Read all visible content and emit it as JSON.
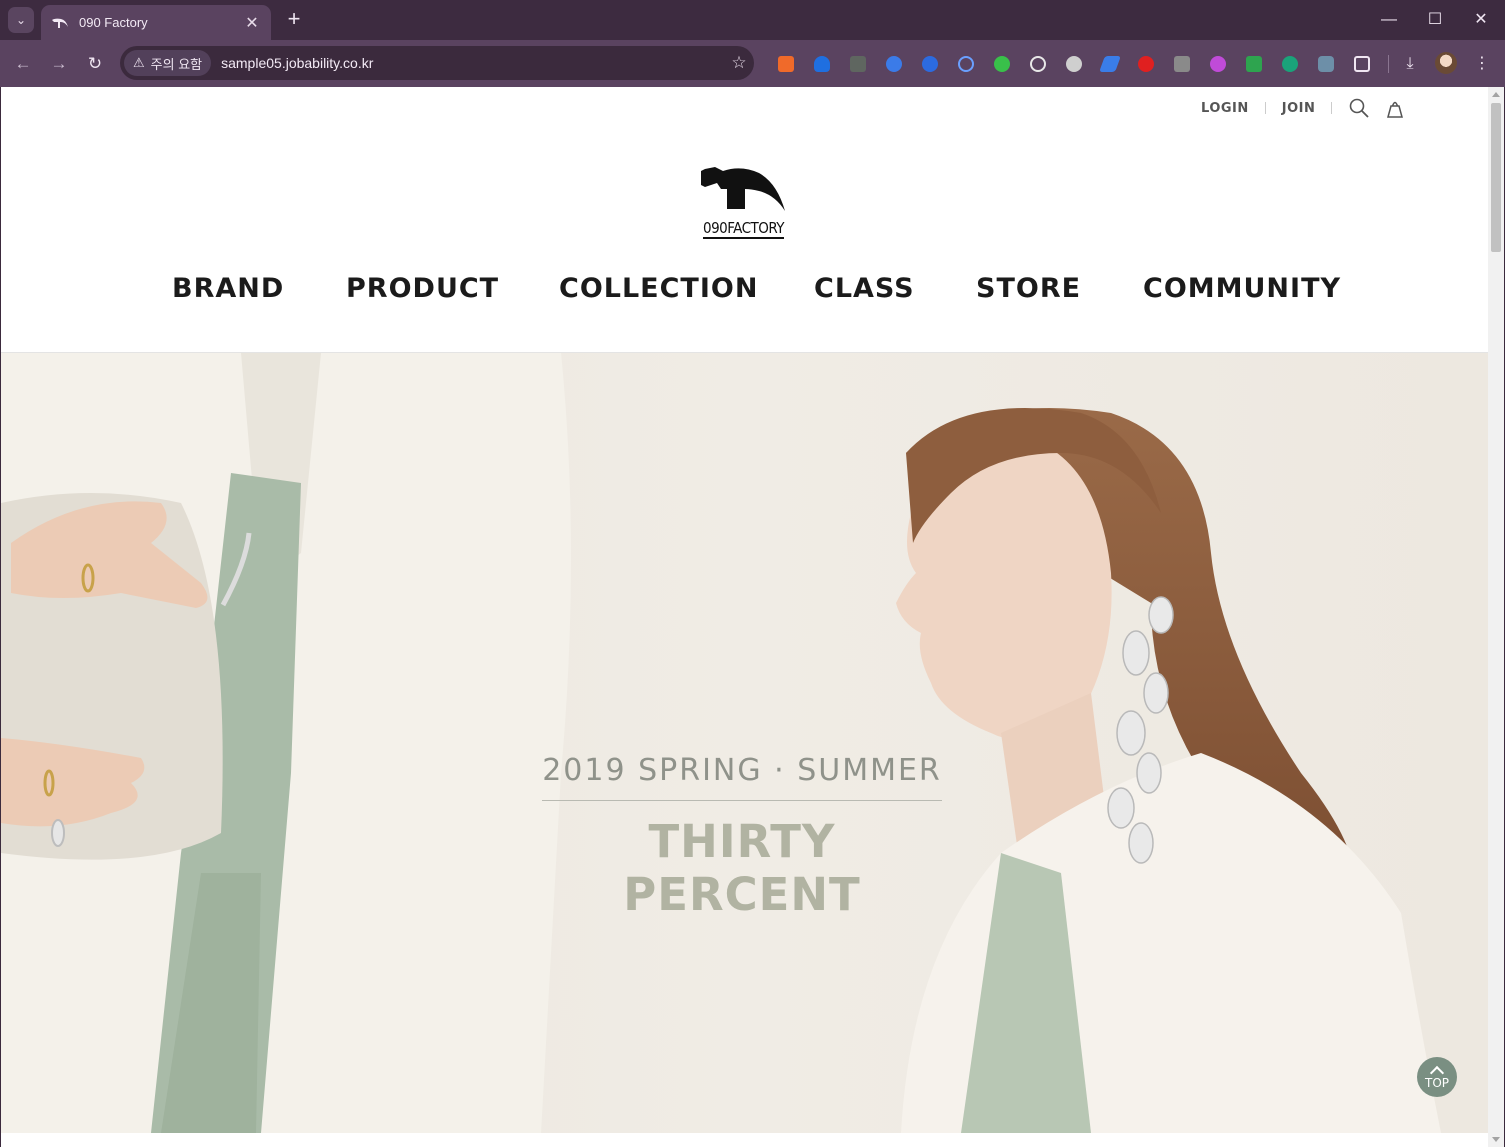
{
  "browser": {
    "tab_title": "090 Factory",
    "tab_close": "✕",
    "new_tab": "+",
    "security_label": "주의 요함",
    "url": "sample05.jobability.co.kr",
    "window_controls": {
      "minimize": "—",
      "maximize": "☐",
      "close": "✕"
    },
    "colors": {
      "frame": "#3d2b40",
      "toolbar": "#5a4360"
    }
  },
  "header": {
    "util_links": {
      "login": "LOGIN",
      "join": "JOIN"
    },
    "logo_text": "090FACTORY",
    "nav": [
      "BRAND",
      "PRODUCT",
      "COLLECTION",
      "CLASS",
      "STORE",
      "COMMUNITY"
    ]
  },
  "hero": {
    "subtitle": "2019 SPRING · SUMMER",
    "title": "THIRTY PERCENT",
    "colors": {
      "background": "#efebe4",
      "title": "#b1b3a2",
      "subtitle": "#8f928a"
    }
  },
  "top_button": {
    "label": "TOP",
    "color": "#7a8f82"
  }
}
